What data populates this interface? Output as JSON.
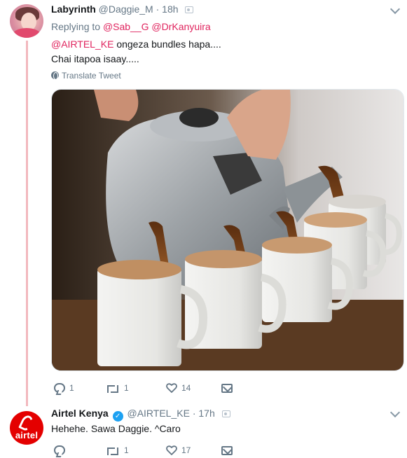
{
  "tweet1": {
    "name": "Labyrinth",
    "handle": "@Daggie_M",
    "separator": "·",
    "time": "18h",
    "replying_prefix": "Replying to",
    "replying_to": [
      "@Sab__G",
      "@DrKanyuira"
    ],
    "text_mention": "@AIRTEL_KE",
    "text_line1_rest": " ongeza bundles hapa....",
    "text_line2": "Chai itapoa isaay.....",
    "translate_label": "Translate Tweet",
    "media_icon": "camera-icon",
    "stats": {
      "replies": "1",
      "retweets": "1",
      "likes": "14"
    }
  },
  "tweet2": {
    "name": "Airtel Kenya",
    "handle": "@AIRTEL_KE",
    "separator": "·",
    "time": "17h",
    "avatar_text": "airtel",
    "text": "Hehehe. Sawa Daggie. ^Caro",
    "stats": {
      "replies": "",
      "retweets": "1",
      "likes": "17"
    }
  },
  "colors": {
    "mention": "#e0245e",
    "secondary": "#657786",
    "thread_line": "#f2b8be",
    "verified": "#1da1f2",
    "airtel_red": "#e40000"
  }
}
